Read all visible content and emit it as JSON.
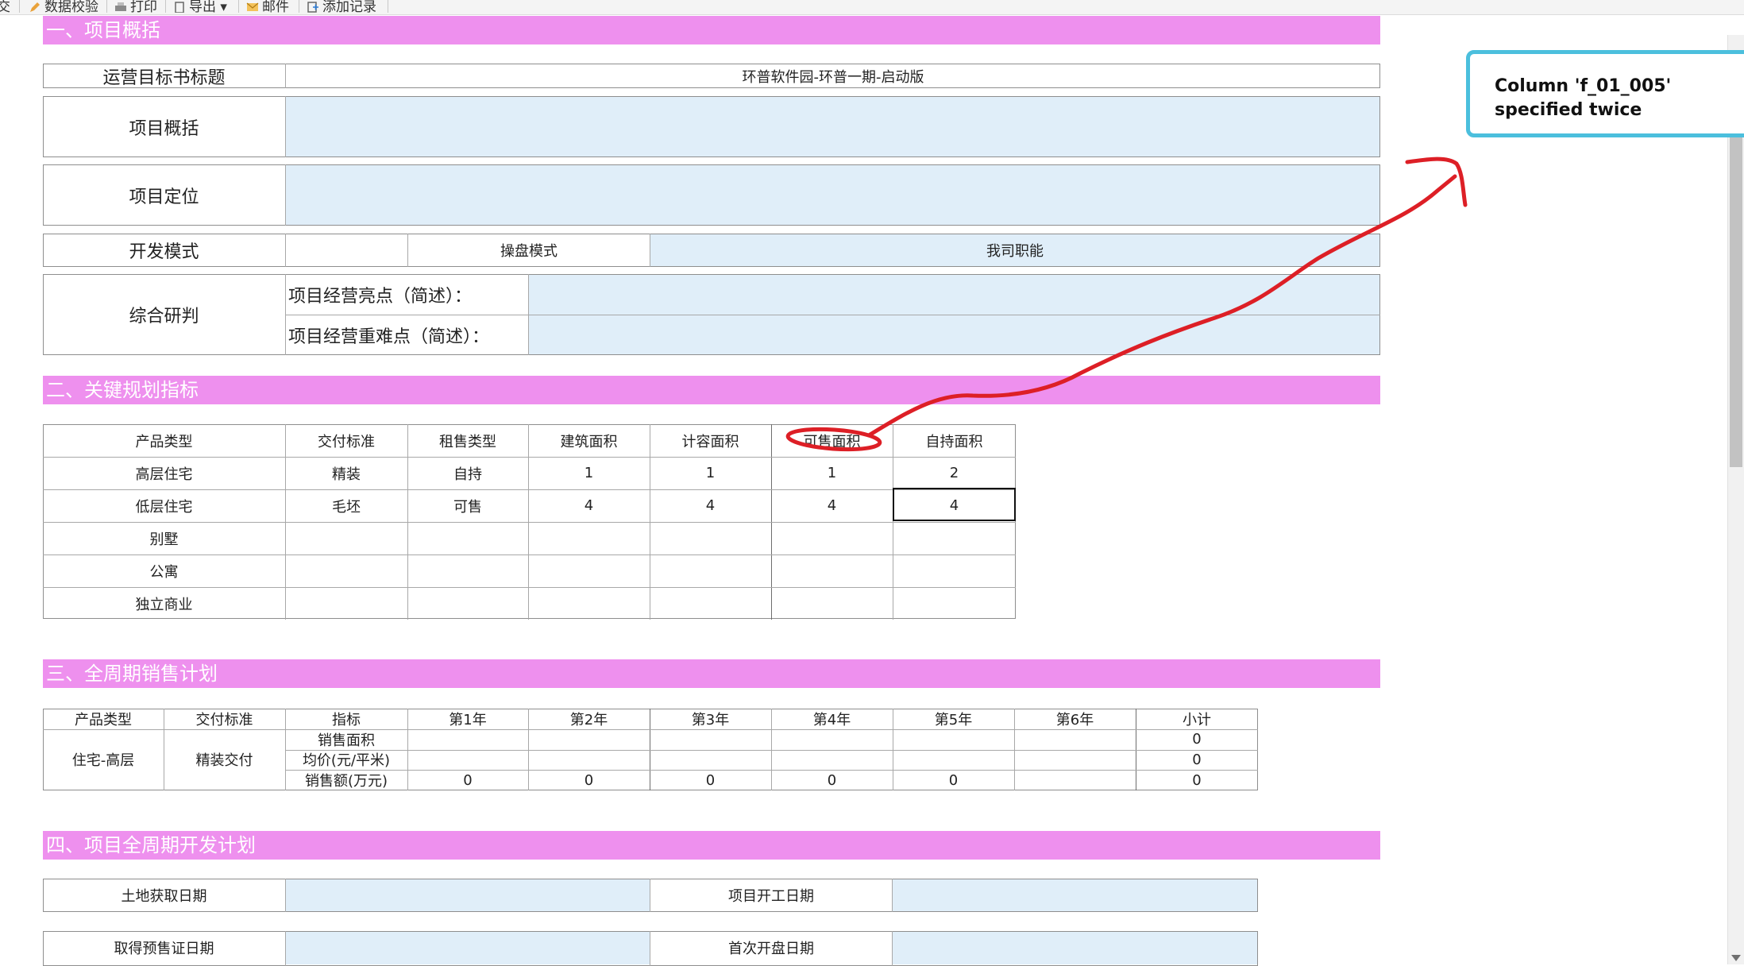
{
  "toolbar": {
    "items": [
      "交",
      "数据校验",
      "打印",
      "导出",
      "邮件",
      "添加记录"
    ]
  },
  "sections": {
    "s1": "一、项目概括",
    "s2": "二、关键规划指标",
    "s3": "三、全周期销售计划",
    "s4": "四、项目全周期开发计划"
  },
  "overview": {
    "title_label": "运营目标书标题",
    "title_value": "环普软件园-环普一期-启动版",
    "summary_label": "项目概括",
    "summary_value": "",
    "position_label": "项目定位",
    "position_value": "",
    "dev_mode_label": "开发模式",
    "dev_mode_value": "",
    "operation_mode_label": "操盘模式",
    "our_role_label": "我司职能",
    "our_role_value": "",
    "research_label": "综合研判",
    "highlights_label": "项目经营亮点（简述）：",
    "highlights_value": "",
    "difficulties_label": "项目经营重难点（简述）：",
    "difficulties_value": ""
  },
  "planning": {
    "headers": [
      "产品类型",
      "交付标准",
      "租售类型",
      "建筑面积",
      "计容面积",
      "可售面积",
      "自持面积"
    ],
    "rows": [
      [
        "高层住宅",
        "精装",
        "自持",
        "1",
        "1",
        "1",
        "2"
      ],
      [
        "低层住宅",
        "毛坯",
        "可售",
        "4",
        "4",
        "4",
        "4"
      ],
      [
        "别墅",
        "",
        "",
        "",
        "",
        "",
        ""
      ],
      [
        "公寓",
        "",
        "",
        "",
        "",
        "",
        ""
      ],
      [
        "独立商业",
        "",
        "",
        "",
        "",
        "",
        ""
      ]
    ]
  },
  "sales": {
    "headers": [
      "产品类型",
      "交付标准",
      "指标",
      "第1年",
      "第2年",
      "第3年",
      "第4年",
      "第5年",
      "第6年",
      "小计"
    ],
    "product_type": "住宅-高层",
    "delivery_standard": "精装交付",
    "rows": [
      {
        "metric": "销售面积",
        "values": [
          "",
          "",
          "",
          "",
          "",
          ""
        ],
        "subtotal": "0"
      },
      {
        "metric": "均价(元/平米)",
        "values": [
          "",
          "",
          "",
          "",
          "",
          ""
        ],
        "subtotal": "0"
      },
      {
        "metric": "销售额(万元)",
        "values": [
          "0",
          "0",
          "0",
          "0",
          "0",
          ""
        ],
        "subtotal": "0"
      }
    ]
  },
  "development": {
    "land_date_label": "土地获取日期",
    "land_date_value": "",
    "start_date_label": "项目开工日期",
    "start_date_value": "",
    "presale_date_label": "取得预售证日期",
    "presale_date_value": "",
    "first_open_label": "首次开盘日期",
    "first_open_value": ""
  },
  "callout": {
    "line1": "Column 'f_01_005'",
    "line2": "specified twice"
  },
  "colors": {
    "section_header": "#ee90ee",
    "input_fill": "#e0eef9",
    "callout_border": "#4bbfdd",
    "annotation_red": "#dd1f26"
  }
}
